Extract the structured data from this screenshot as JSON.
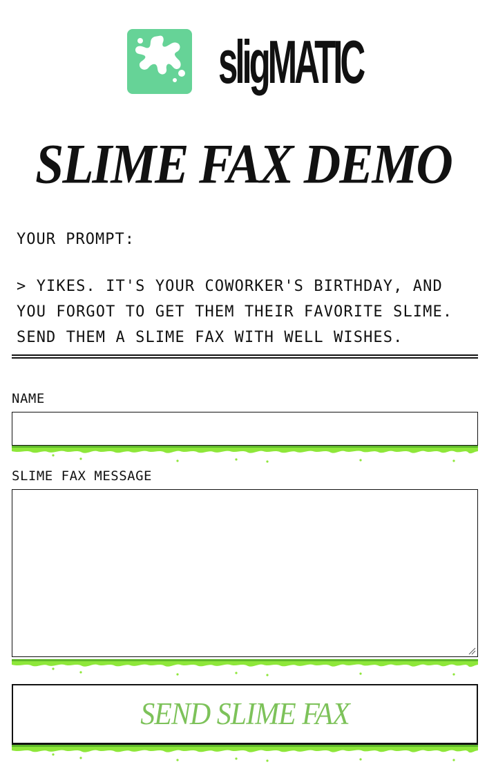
{
  "header": {
    "brand": "sligMATIC",
    "logo_color": "#66d397"
  },
  "page_title": "SLIME FAX DEMO",
  "prompt": {
    "label": "YOUR PROMPT:",
    "text": "> YIKES. IT'S YOUR COWORKER'S BIRTHDAY, AND YOU FORGOT TO GET THEM THEIR FAVORITE SLIME. SEND THEM A SLIME FAX WITH WELL WISHES."
  },
  "form": {
    "name_label": "NAME",
    "name_value": "",
    "message_label": "SLIME FAX MESSAGE",
    "message_value": "",
    "submit_label": "SEND SLIME FAX"
  },
  "colors": {
    "slime": "#8ee73a",
    "slime_dark": "#5fb82a",
    "button_text": "#7dc25a"
  }
}
